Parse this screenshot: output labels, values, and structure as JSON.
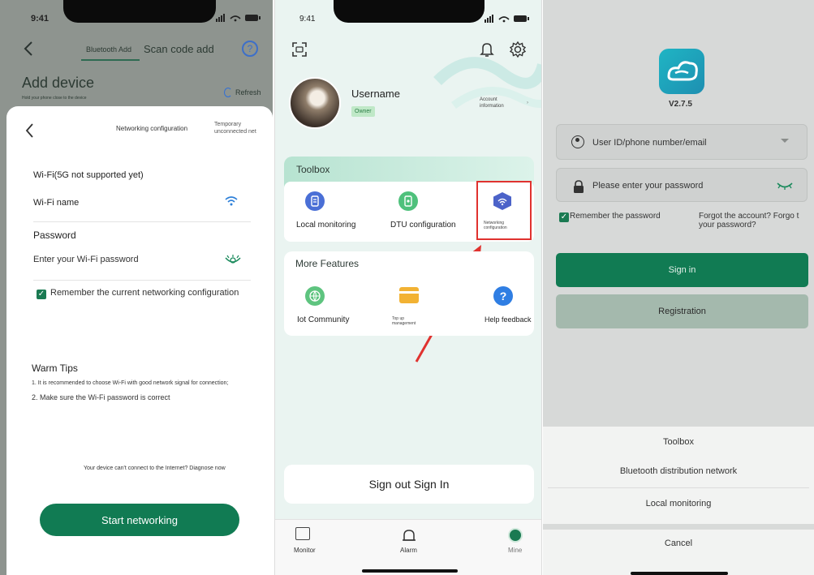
{
  "status": {
    "time": "9:41",
    "signal": "▂▄▆█",
    "wifi": "wifi",
    "battery": "battery"
  },
  "screen1": {
    "tab_bluetooth": "Bluetooth Add",
    "tab_scan": "Scan code add",
    "help": "?",
    "title": "Add device",
    "hint": "Hold your phone close to the device",
    "refresh": "Refresh",
    "sheet_title": "Networking configuration",
    "temp": "Temporary unconnected net",
    "wifi_note": "Wi-Fi(5G not supported yet)",
    "wifi_name_label": "Wi-Fi name",
    "password_label": "Password",
    "password_placeholder": "Enter your Wi-Fi password",
    "remember_label": "Remember the current networking configuration",
    "tips_title": "Warm Tips",
    "tip1": "1. It is recommended to choose Wi-Fi with good network signal for connection;",
    "tip2": "2. Make sure the Wi-Fi password is correct",
    "diagnose": "Your device can't connect to the Internet? Diagnose now",
    "start_button": "Start networking"
  },
  "screen2": {
    "username": "Username",
    "role": "Owner",
    "account_info": "Account information",
    "toolbox_title": "Toolbox",
    "tools": [
      "Local monitoring",
      "DTU configuration",
      "Networking configuration"
    ],
    "more_title": "More Features",
    "features": [
      "Iot Community",
      "Top up management",
      "Help feedback"
    ],
    "sign_out": "Sign out Sign In",
    "nav": [
      "Monitor",
      "Alarm",
      "Mine"
    ],
    "highlight_color": "#e0322f"
  },
  "screen3": {
    "version": "V2.7.5",
    "user_placeholder": "User ID/phone number/email",
    "password_placeholder": "Please enter your password",
    "remember": "Remember the password",
    "forgot": "Forgot the account? Forgo t your password?",
    "sign_in": "Sign in",
    "registration": "Registration",
    "sheet_items": [
      "Toolbox",
      "Bluetooth distribution network",
      "Local monitoring"
    ],
    "cancel": "Cancel"
  },
  "colors": {
    "brand_green": "#117b53",
    "accent_blue": "#4a6fd6",
    "red": "#e0322f"
  }
}
